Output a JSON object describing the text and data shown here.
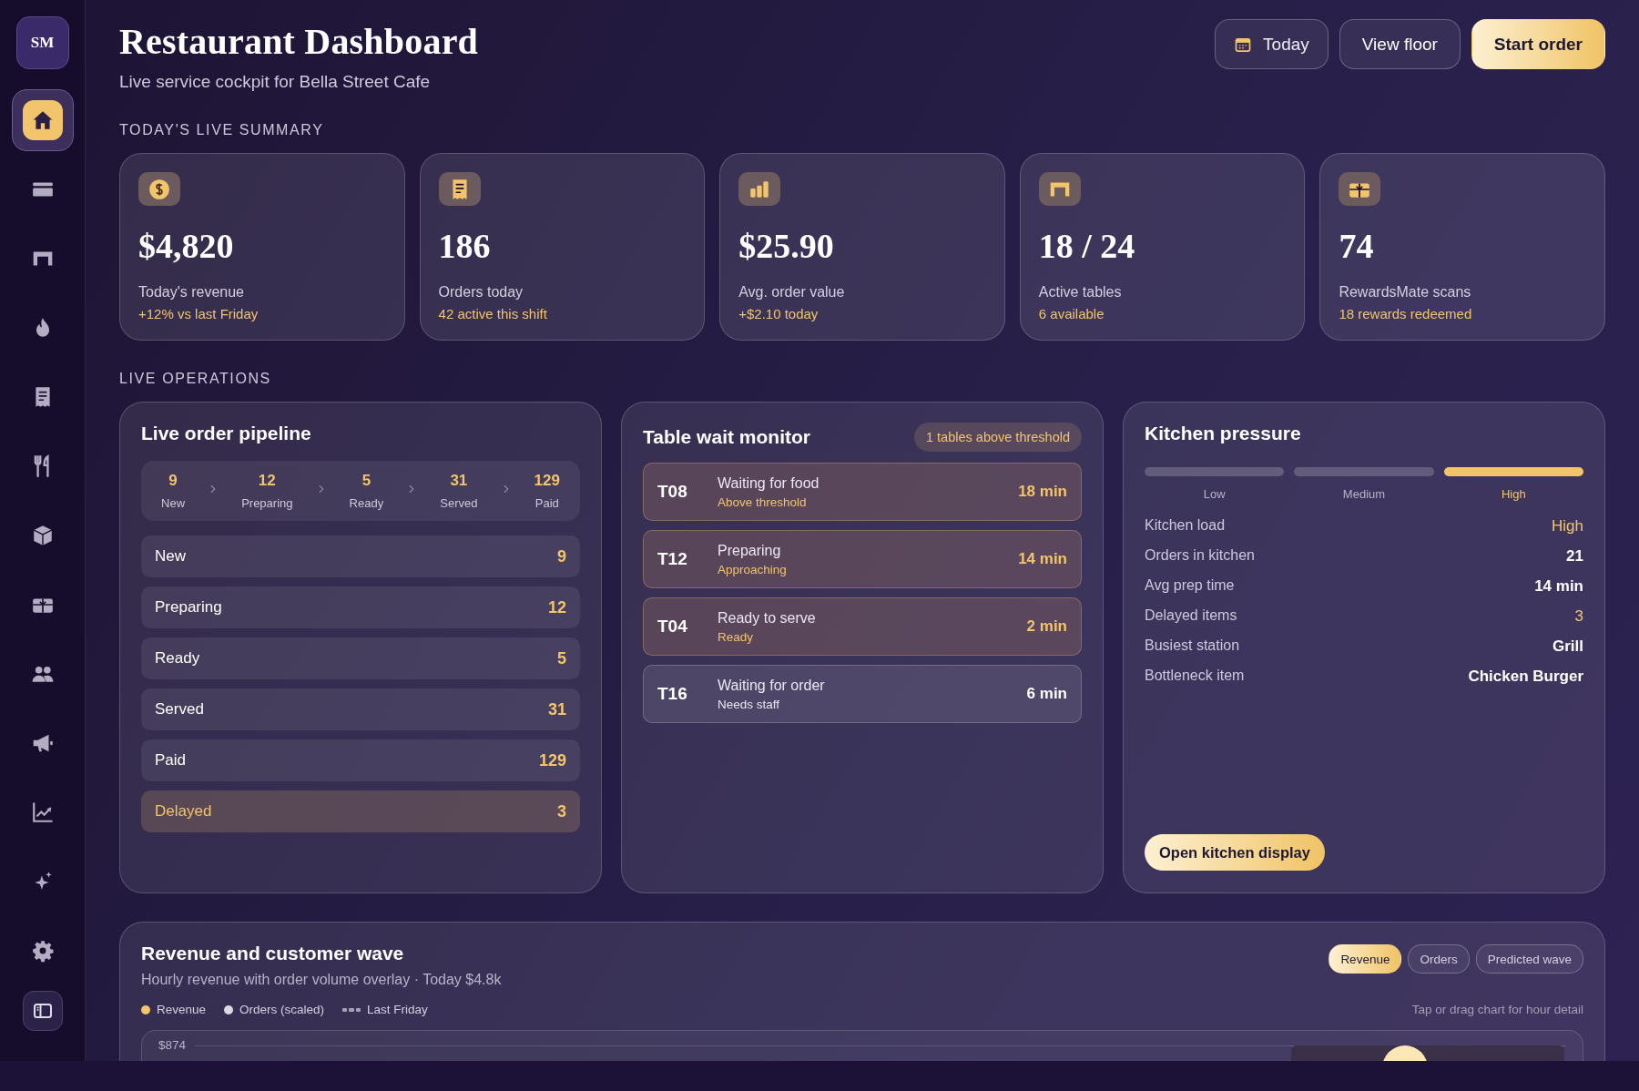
{
  "sidebar": {
    "avatar": "SM",
    "items": [
      {
        "selected": true
      },
      {
        "selected": false
      },
      {
        "selected": false
      },
      {
        "selected": false
      },
      {
        "selected": false
      },
      {
        "selected": false
      },
      {
        "selected": false
      },
      {
        "selected": false
      },
      {
        "selected": false
      },
      {
        "selected": false
      },
      {
        "selected": false
      },
      {
        "selected": false
      },
      {
        "selected": false
      }
    ],
    "toggle": {
      "selected": false
    }
  },
  "header": {
    "title": "Restaurant Dashboard",
    "subtitle": "Live service cockpit for Bella Street Cafe",
    "buttons": [
      {
        "label": "Today",
        "kind": "date"
      },
      {
        "label": "View floor",
        "kind": "outline"
      },
      {
        "label": "Start order",
        "kind": "primary"
      }
    ]
  },
  "summary": {
    "heading": "TODAY'S LIVE SUMMARY",
    "cards": [
      {
        "value": "$4,820",
        "label": "Today's revenue",
        "note": "+12% vs last Friday"
      },
      {
        "value": "186",
        "label": "Orders today",
        "note": "42 active this shift"
      },
      {
        "value": "$25.90",
        "label": "Avg. order value",
        "note": "+$2.10 today"
      },
      {
        "value": "18 / 24",
        "label": "Active tables",
        "note": "6 available"
      },
      {
        "value": "74",
        "label": "RewardsMate scans",
        "note": "18 rewards redeemed"
      }
    ]
  },
  "operations": {
    "heading": "LIVE OPERATIONS"
  },
  "pipeline": {
    "title": "Live order pipeline",
    "steps": [
      {
        "count": "9",
        "label": "New"
      },
      {
        "count": "12",
        "label": "Preparing"
      },
      {
        "count": "5",
        "label": "Ready"
      },
      {
        "count": "31",
        "label": "Served"
      },
      {
        "count": "129",
        "label": "Paid"
      }
    ],
    "rows": [
      {
        "label": "New",
        "count": "9",
        "flagged": false
      },
      {
        "label": "Preparing",
        "count": "12",
        "flagged": false
      },
      {
        "label": "Ready",
        "count": "5",
        "flagged": false
      },
      {
        "label": "Served",
        "count": "31",
        "flagged": false
      },
      {
        "label": "Paid",
        "count": "129",
        "flagged": false
      },
      {
        "label": "Delayed",
        "count": "3",
        "flagged": true
      }
    ]
  },
  "wait_monitor": {
    "title": "Table wait monitor",
    "badge": "1 tables above threshold",
    "tables": [
      {
        "table": "T08",
        "status": "Waiting for food",
        "note": "Above threshold",
        "time": "18 min",
        "highlighted": true
      },
      {
        "table": "T12",
        "status": "Preparing",
        "note": "Approaching",
        "time": "14 min",
        "highlighted": true
      },
      {
        "table": "T04",
        "status": "Ready to serve",
        "note": "Ready",
        "time": "2 min",
        "highlighted": true
      },
      {
        "table": "T16",
        "status": "Waiting for order",
        "note": "Needs staff",
        "time": "6 min",
        "highlighted": false
      }
    ]
  },
  "kitchen": {
    "title": "Kitchen pressure",
    "scale": [
      {
        "label": "Low",
        "selected": false
      },
      {
        "label": "Medium",
        "selected": false
      },
      {
        "label": "High",
        "selected": true
      }
    ],
    "stats": [
      {
        "label": "Kitchen load",
        "value": "High",
        "accent": true
      },
      {
        "label": "Orders in kitchen",
        "value": "21",
        "accent": false
      },
      {
        "label": "Avg prep time",
        "value": "14 min",
        "accent": false
      },
      {
        "label": "Delayed items",
        "value": "3",
        "accent": true
      },
      {
        "label": "Busiest station",
        "value": "Grill",
        "accent": false
      },
      {
        "label": "Bottleneck item",
        "value": "Chicken Burger",
        "accent": false
      }
    ],
    "button": "Open kitchen display"
  },
  "wave": {
    "title": "Revenue and customer wave",
    "subtitle": "Hourly revenue with order volume overlay · Today $4.8k",
    "toggles": [
      {
        "label": "Revenue",
        "selected": true
      },
      {
        "label": "Orders",
        "selected": false
      },
      {
        "label": "Predicted wave",
        "selected": false
      }
    ],
    "legend": [
      {
        "label": "Revenue",
        "kind": "dot",
        "color": "#f2c46b"
      },
      {
        "label": "Orders (scaled)",
        "kind": "dot",
        "color": "#dcd8e4"
      },
      {
        "label": "Last Friday",
        "kind": "dash",
        "color": "#a59fb8"
      }
    ],
    "hint": "Tap or drag chart for hour detail",
    "axis_label": "$874"
  }
}
